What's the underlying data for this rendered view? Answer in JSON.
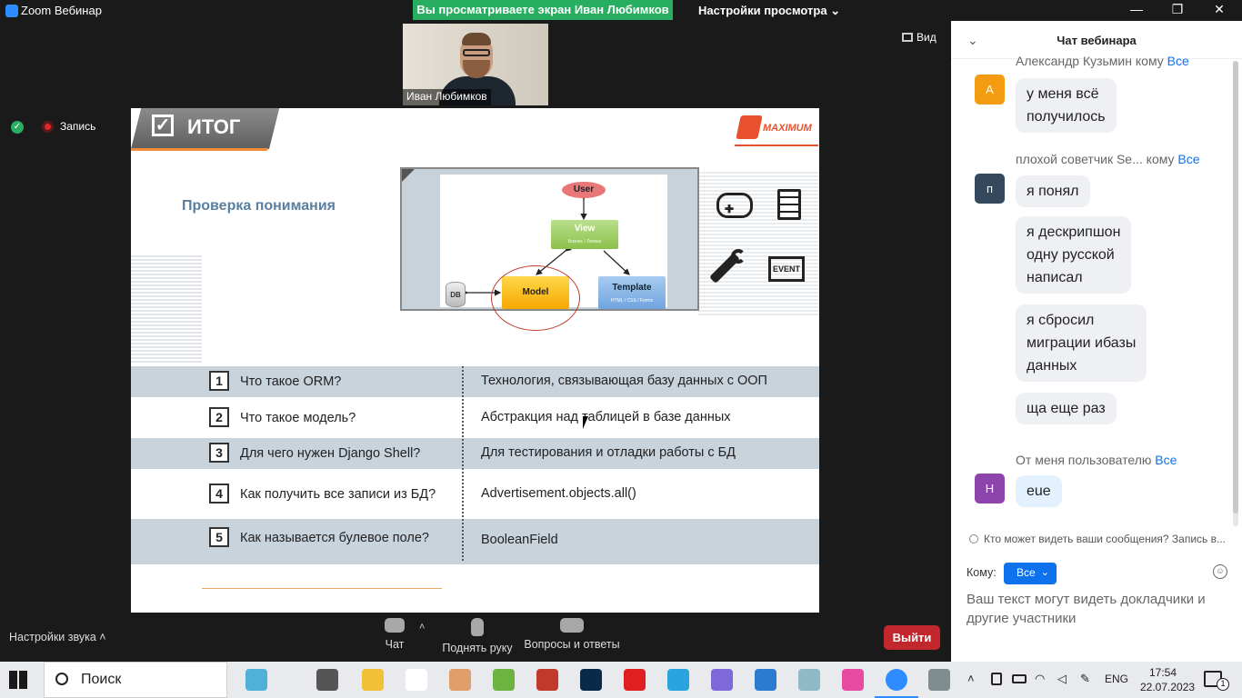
{
  "window": {
    "title": "Zoom Вебинар",
    "viewing_banner": "Вы просматриваете экран Иван Любимков",
    "view_settings": "Настройки просмотра",
    "minimize": "—",
    "restore": "❐",
    "close": "✕"
  },
  "video": {
    "presenter_name": "Иван Любимков",
    "view_label": "Вид",
    "record_label": "Запись"
  },
  "slide": {
    "heading": "ИТОГ",
    "check_glyph": "✓",
    "logo_text": "MAXIMUM",
    "subtitle": "Проверка понимания",
    "diagram": {
      "user": "User",
      "view": "View",
      "view_sub": "Бизнес / Логика",
      "model": "Model",
      "template": "Template",
      "template_sub": "HTML / CSS / Forms",
      "db": "DB"
    },
    "event_label": "EVENT",
    "rows": [
      {
        "num": "1",
        "q": "Что такое ORM?",
        "a": "Технология, связывающая базу данных с ООП"
      },
      {
        "num": "2",
        "q": "Что такое модель?",
        "a": "Абстракция над таблицей в базе данных"
      },
      {
        "num": "3",
        "q": "Для чего нужен Django Shell?",
        "a": "Для тестирования и отладки работы с БД"
      },
      {
        "num": "4",
        "q": "Как получить все записи из БД?",
        "a": "Advertisement.objects.all()"
      },
      {
        "num": "5",
        "q": "Как называется булевое поле?",
        "a": "BooleanField"
      }
    ]
  },
  "controls": {
    "audio_settings": "Настройки звука",
    "chat": "Чат",
    "raise_hand": "Поднять руку",
    "qa": "Вопросы и ответы",
    "leave": "Выйти"
  },
  "chat": {
    "title": "Чат вебинара",
    "messages": [
      {
        "avatar": "А",
        "avatar_color": "#f39c12",
        "sender": "Александр Кузьмин",
        "to_word": "кому",
        "to": "Все",
        "lines": [
          "у меня всё",
          "получилось"
        ]
      },
      {
        "avatar": "п",
        "avatar_color": "#34495e",
        "sender": "плохой советчик Se...",
        "to_word": "кому",
        "to": "Все",
        "bubbles": [
          [
            "я понял"
          ],
          [
            "я дескрипшон",
            "одну русской",
            "написал"
          ],
          [
            "я сбросил",
            "миграции ибазы",
            "данных"
          ],
          [
            "ща еще раз"
          ]
        ]
      },
      {
        "avatar": "Н",
        "avatar_color": "#8e44ad",
        "sender": "От меня пользователю",
        "to": "Все",
        "lines": [
          "eue"
        ]
      }
    ],
    "who_sees": "Кто может видеть ваши сообщения? Запись в...",
    "to_label": "Кому:",
    "to_value": "Все",
    "input_placeholder": "Ваш текст могут видеть докладчики и другие участники"
  },
  "taskbar": {
    "search": "Поиск",
    "lang": "ENG",
    "time": "17:54",
    "date": "22.07.2023",
    "notif_count": "1",
    "apps": [
      {
        "name": "beach-app-icon",
        "color": "#4fb0d8"
      },
      {
        "name": "task-view-icon",
        "color": "#555555"
      },
      {
        "name": "file-explorer-icon",
        "color": "#f2c037"
      },
      {
        "name": "notepad-icon",
        "color": "#ffffff"
      },
      {
        "name": "paint-icon",
        "color": "#e09e6a"
      },
      {
        "name": "qgis-icon",
        "color": "#6cb33f"
      },
      {
        "name": "abbyy-icon",
        "color": "#c0392b"
      },
      {
        "name": "photoshop-icon",
        "color": "#0a2a4a"
      },
      {
        "name": "yandex-icon",
        "color": "#e02020"
      },
      {
        "name": "telegram-icon",
        "color": "#2aa3df"
      },
      {
        "name": "discord-icon",
        "color": "#7d6ad8"
      },
      {
        "name": "vscode-icon",
        "color": "#2b7bd0"
      },
      {
        "name": "sketch-icon",
        "color": "#8fb9c6"
      },
      {
        "name": "gem-icon",
        "color": "#e84aa0"
      },
      {
        "name": "zoom-icon",
        "color": "#2d8cff"
      },
      {
        "name": "database-icon",
        "color": "#7f8c8d"
      }
    ]
  }
}
